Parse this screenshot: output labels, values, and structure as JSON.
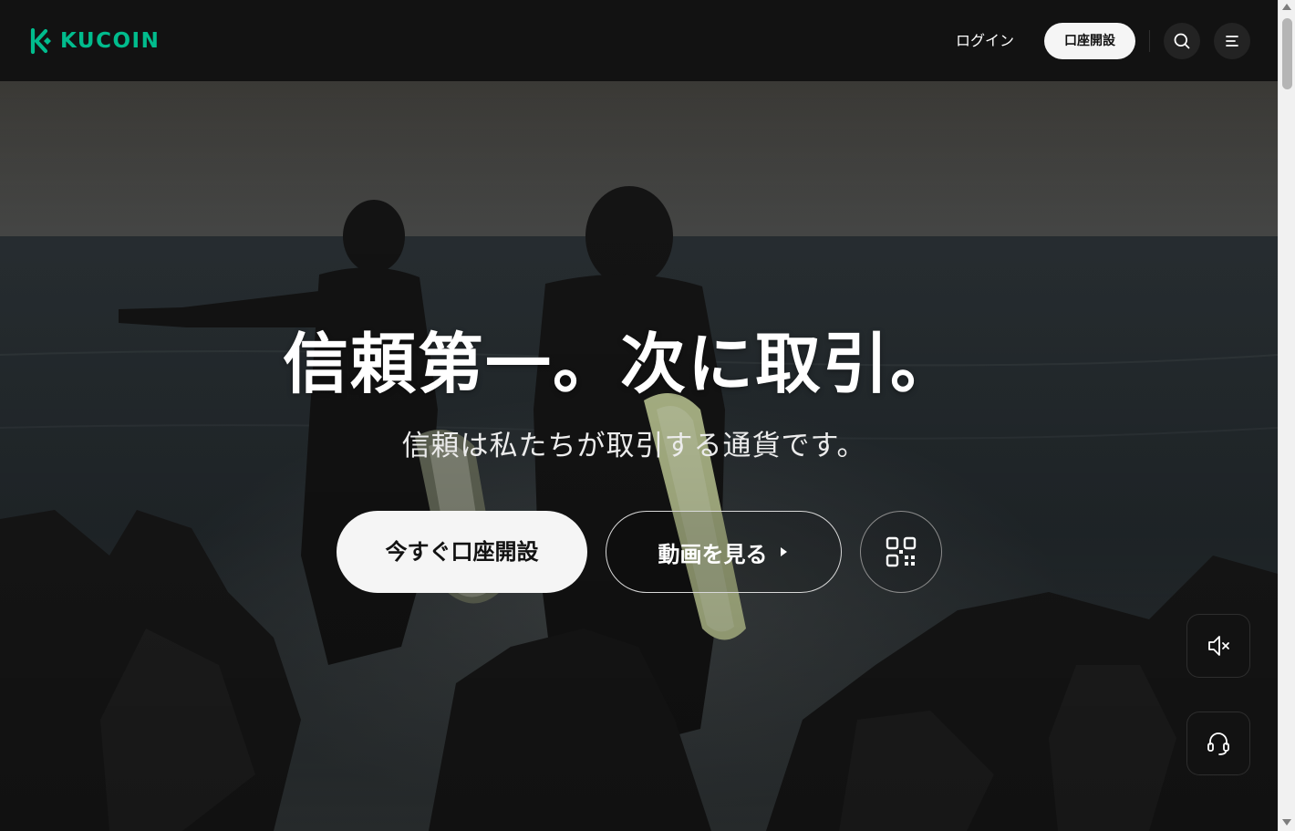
{
  "header": {
    "logo_text": "KUCOIN",
    "login_label": "ログイン",
    "signup_label": "口座開設",
    "search_icon": "search-icon",
    "menu_icon": "menu-icon"
  },
  "hero": {
    "title": "信頼第一。次に取引。",
    "subtitle": "信頼は私たちが取引する通貨です。",
    "cta_primary_label": "今すぐ口座開設",
    "cta_video_label": "動画を見る",
    "qr_icon": "qr-code-icon",
    "background": "photo of two surfers on rocks looking at the sea"
  },
  "floating": {
    "mute_icon": "speaker-muted-icon",
    "support_icon": "headset-icon"
  },
  "colors": {
    "brand": "#01bc8d",
    "header_bg": "#121212",
    "button_light": "#f5f5f5"
  }
}
